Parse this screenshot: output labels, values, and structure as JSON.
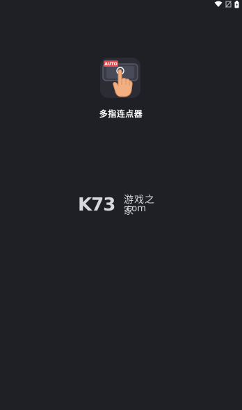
{
  "status_bar": {
    "icons": [
      "wifi-icon",
      "sim-off-icon",
      "battery-icon"
    ]
  },
  "app": {
    "name": "多指连点器",
    "icon": "auto-clicker-app-icon",
    "icon_badge": "AUTO",
    "colors": {
      "background": "#1f2026",
      "badge": "#e5484d",
      "hand": "#f2b082"
    }
  },
  "watermark": {
    "brand": "K73",
    "cn_text": "游戏之家",
    "domain": ".com"
  }
}
